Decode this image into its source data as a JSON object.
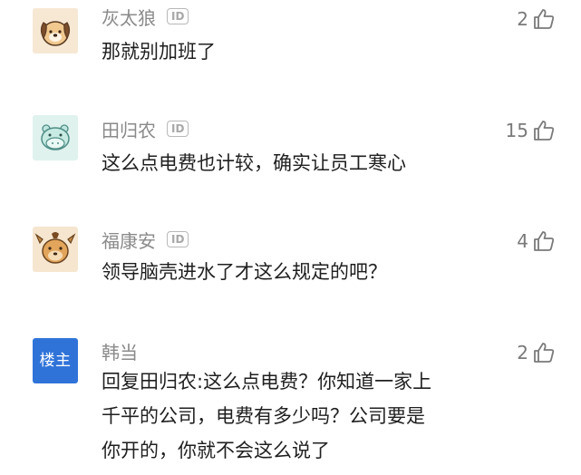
{
  "comments": [
    {
      "username": "灰太狼",
      "text": "那就别加班了",
      "likes": "2",
      "avatar": "dog-avatar"
    },
    {
      "username": "田归农",
      "text": "这么点电费也计较，确实让员工寒心",
      "likes": "15",
      "avatar": "hippo-avatar"
    },
    {
      "username": "福康安",
      "text": "领导脑壳进水了才这么规定的吧？",
      "likes": "4",
      "avatar": "deer-avatar"
    },
    {
      "username": "韩当",
      "badge": "楼主",
      "reply_prefix": "回复田归农:",
      "lines": [
        "这么点电费？你知道一家上",
        "千平的公司，电费有多少吗？公司要是",
        "你开的，你就不会这么说了"
      ],
      "likes": "2"
    }
  ],
  "id_badge_label": "ID",
  "colors": {
    "author_badge": "#2f73d9",
    "username": "#8a8a8a",
    "text": "#1f1f1f"
  }
}
